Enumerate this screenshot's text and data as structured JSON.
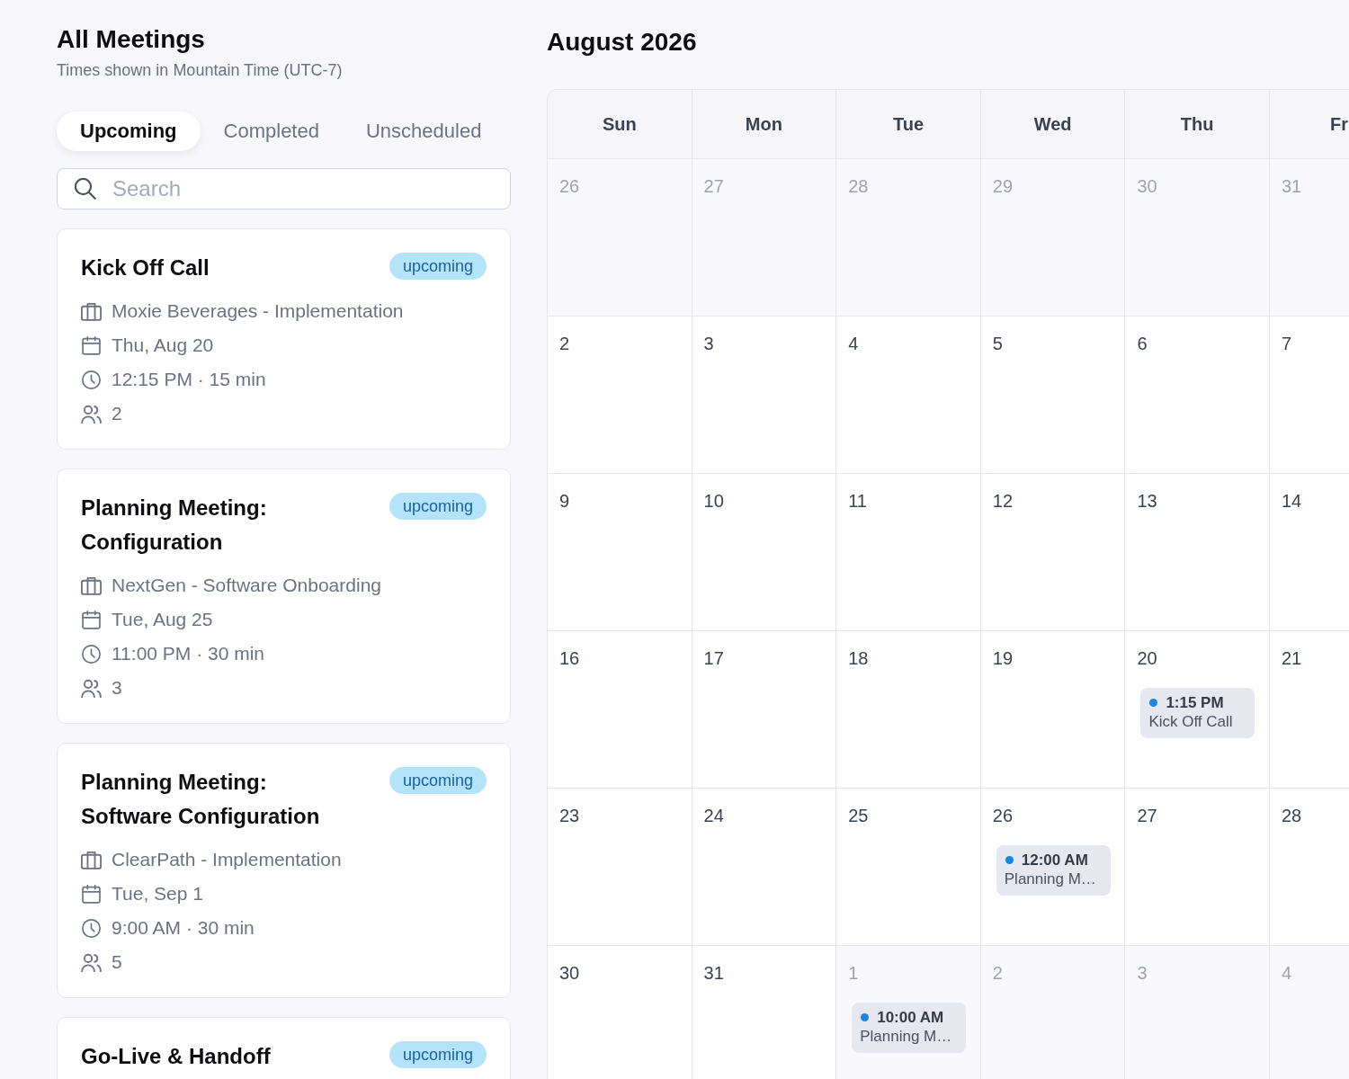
{
  "header": {
    "title": "All Meetings",
    "subtitle": "Times shown in Mountain Time (UTC-7)"
  },
  "tabs": [
    {
      "label": "Upcoming",
      "selected": true
    },
    {
      "label": "Completed",
      "selected": false
    },
    {
      "label": "Unscheduled",
      "selected": false
    }
  ],
  "search": {
    "placeholder": "Search"
  },
  "meetings": [
    {
      "title": "Kick Off Call",
      "status": "upcoming",
      "account": "Moxie Beverages - Implementation",
      "date": "Thu, Aug 20",
      "time": "12:15 PM · 15 min",
      "attendees": "2"
    },
    {
      "title": "Planning Meeting: Configuration",
      "status": "upcoming",
      "account": "NextGen - Software Onboarding",
      "date": "Tue, Aug 25",
      "time": "11:00 PM · 30 min",
      "attendees": "3"
    },
    {
      "title": "Planning Meeting: Software Configuration",
      "status": "upcoming",
      "account": "ClearPath - Implementation",
      "date": "Tue, Sep 1",
      "time": "9:00 AM · 30 min",
      "attendees": "5"
    },
    {
      "title": "Go-Live & Handoff",
      "status": "upcoming"
    }
  ],
  "calendar": {
    "title": "August 2026",
    "weekdays": [
      "Sun",
      "Mon",
      "Tue",
      "Wed",
      "Thu",
      "Fr"
    ],
    "weeks": [
      [
        {
          "day": "26",
          "in_month": false
        },
        {
          "day": "27",
          "in_month": false
        },
        {
          "day": "28",
          "in_month": false
        },
        {
          "day": "29",
          "in_month": false
        },
        {
          "day": "30",
          "in_month": false
        },
        {
          "day": "31",
          "in_month": false
        }
      ],
      [
        {
          "day": "2",
          "in_month": true
        },
        {
          "day": "3",
          "in_month": true
        },
        {
          "day": "4",
          "in_month": true
        },
        {
          "day": "5",
          "in_month": true
        },
        {
          "day": "6",
          "in_month": true
        },
        {
          "day": "7",
          "in_month": true
        }
      ],
      [
        {
          "day": "9",
          "in_month": true
        },
        {
          "day": "10",
          "in_month": true
        },
        {
          "day": "11",
          "in_month": true
        },
        {
          "day": "12",
          "in_month": true
        },
        {
          "day": "13",
          "in_month": true
        },
        {
          "day": "14",
          "in_month": true
        }
      ],
      [
        {
          "day": "16",
          "in_month": true
        },
        {
          "day": "17",
          "in_month": true
        },
        {
          "day": "18",
          "in_month": true
        },
        {
          "day": "19",
          "in_month": true
        },
        {
          "day": "20",
          "in_month": true,
          "events": [
            {
              "time": "1:15 PM",
              "title": "Kick Off Call"
            }
          ]
        },
        {
          "day": "21",
          "in_month": true
        }
      ],
      [
        {
          "day": "23",
          "in_month": true
        },
        {
          "day": "24",
          "in_month": true
        },
        {
          "day": "25",
          "in_month": true
        },
        {
          "day": "26",
          "in_month": true,
          "events": [
            {
              "time": "12:00 AM",
              "title": "Planning M…"
            }
          ]
        },
        {
          "day": "27",
          "in_month": true
        },
        {
          "day": "28",
          "in_month": true
        }
      ],
      [
        {
          "day": "30",
          "in_month": true
        },
        {
          "day": "31",
          "in_month": true
        },
        {
          "day": "1",
          "in_month": false,
          "events": [
            {
              "time": "10:00 AM",
              "title": "Planning M…"
            }
          ]
        },
        {
          "day": "2",
          "in_month": false
        },
        {
          "day": "3",
          "in_month": false
        },
        {
          "day": "4",
          "in_month": false
        }
      ]
    ]
  }
}
